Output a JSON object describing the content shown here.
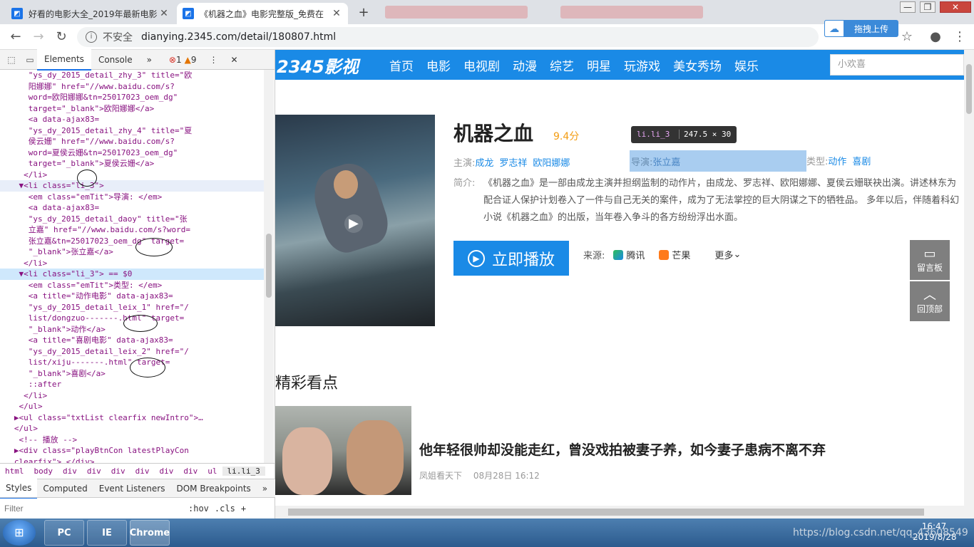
{
  "browser": {
    "tabs": [
      {
        "title": "好看的电影大全_2019年最新电影",
        "active": false,
        "favicon": "2345-icon"
      },
      {
        "title": "《机器之血》电影完整版_免费在",
        "active": true,
        "favicon": "2345-icon"
      }
    ],
    "new_tab": "+",
    "window_controls": [
      "—",
      "❐",
      "✕"
    ],
    "security": "不安全",
    "url": "dianying.2345.com/detail/180807.html",
    "upload_label": "拖拽上传"
  },
  "devtools": {
    "tabs": [
      "Elements",
      "Console"
    ],
    "more": "»",
    "errors": "1",
    "warnings": "9",
    "code_lines": [
      "      \"ys_dy_2015_detail_zhy_3\" title=\"欧",
      "      阳娜娜\" href=\"//www.baidu.com/s?",
      "      word=欧阳娜娜&tn=25017023_oem_dg\"",
      "      target=\"_blank\">欧阳娜娜</a>",
      "      <a data-ajax83=",
      "      \"ys_dy_2015_detail_zhy_4\" title=\"夏",
      "      侯云姗\" href=\"//www.baidu.com/s?",
      "      word=夏侯云姗&tn=25017023_oem_dg\"",
      "      target=\"_blank\">夏侯云姗</a>",
      "     </li>",
      "    ▼<li class=\"li_3\">",
      "      <em class=\"emTit\">导演: </em>",
      "      <a data-ajax83=",
      "      \"ys_dy_2015_detail_daoy\" title=\"张",
      "      立嘉\" href=\"//www.baidu.com/s?word=",
      "      张立嘉&tn=25017023_oem_dg\" target=",
      "      \"_blank\">张立嘉</a>",
      "     </li>",
      "    ▼<li class=\"li_3\"> == $0",
      "      <em class=\"emTit\">类型: </em>",
      "      <a title=\"动作电影\" data-ajax83=",
      "      \"ys_dy_2015_detail_leix_1\" href=\"/",
      "      list/dongzuo-------.html\" target=",
      "      \"_blank\">动作</a>",
      "      <a title=\"喜剧电影\" data-ajax83=",
      "      \"ys_dy_2015_detail_leix_2\" href=\"/",
      "      list/xiju-------.html\" target=",
      "      \"_blank\">喜剧</a>",
      "      ::after",
      "     </li>",
      "    </ul>",
      "   ▶<ul class=\"txtList clearfix newIntro\">…",
      "   </ul>",
      "    <!-- 播放 -->",
      "   ▶<div class=\"playBtnCon latestPlayCon",
      "   clearfix\">…</div>"
    ],
    "breadcrumbs": [
      "html",
      "body",
      "div",
      "div",
      "div",
      "div",
      "div",
      "div",
      "ul",
      "li.li_3"
    ],
    "subtabs": [
      "Styles",
      "Computed",
      "Event Listeners",
      "DOM Breakpoints",
      "»"
    ],
    "filter_placeholder": "Filter",
    "hov": ":hov",
    "cls": ".cls",
    "plus": "+"
  },
  "site": {
    "logo": "2345影视",
    "nav": [
      "首页",
      "电影",
      "电视剧",
      "动漫",
      "综艺",
      "明星",
      "玩游戏",
      "美女秀场",
      "娱乐"
    ],
    "search_placeholder": "小欢喜",
    "title": "机器之血",
    "score": "9.4分",
    "tooltip_tag": "li.li_3",
    "tooltip_size": "247.5 × 30",
    "cast_label": "主演:",
    "cast": [
      "成龙",
      "罗志祥",
      "欧阳娜娜"
    ],
    "director_label": "导演:",
    "director": "张立嘉",
    "genre_label": "类型:",
    "genres": [
      "动作",
      "喜剧"
    ],
    "intro_label": "简介:",
    "intro": "《机器之血》是一部由成龙主演并担纲监制的动作片，由成龙、罗志祥、欧阳娜娜、夏侯云姗联袂出演。讲述林东为配合证人保护计划卷入了一件与自己无关的案件，成为了无法掌控的巨大阴谋之下的牺牲品。 多年以后，伴随着科幻小说《机器之血》的出版，当年卷入争斗的各方纷纷浮出水面。",
    "play_label": "立即播放",
    "source_label": "来源:",
    "sources": [
      "腾讯",
      "芒果"
    ],
    "more": "更多",
    "section_title": "精彩看点",
    "news_title": "他年轻很帅却没能走红，曾没戏拍被妻子养，如今妻子患病不离不弃",
    "news_author": "凤姐看天下",
    "news_time": "08月28日 16:12",
    "side_buttons": [
      "留言板",
      "回顶部"
    ]
  },
  "taskbar": {
    "apps": [
      "PC",
      "IE",
      "Chrome"
    ],
    "time": "16:47",
    "date": "2019/8/28",
    "watermark": "https://blog.csdn.net/qq_43608549"
  }
}
